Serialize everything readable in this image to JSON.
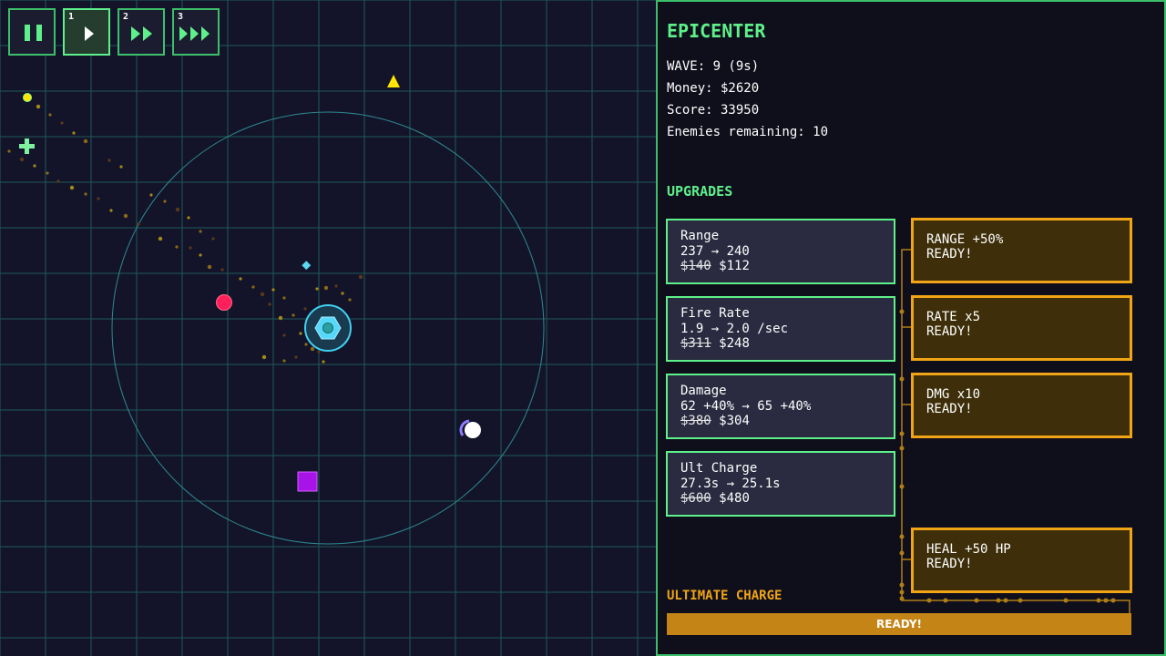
{
  "colors": {
    "accent": "#5ef08a",
    "ultimate": "#f0a416",
    "range_ring": "#2e8a90",
    "tower": "#40d0f0"
  },
  "speed_controls": [
    {
      "hotkey": "1",
      "icon": "play-icon"
    },
    {
      "hotkey": "2",
      "icon": "fast-forward-icon"
    },
    {
      "hotkey": "3",
      "icon": "triple-fast-forward-icon"
    }
  ],
  "pause_icon": "pause-icon",
  "panel": {
    "title": "EPICENTER",
    "wave": "WAVE: 9 (9s)",
    "money": "Money: $2620",
    "score": "Score: 33950",
    "enemies": "Enemies remaining: 10",
    "upgrades_heading": "UPGRADES",
    "upgrades": [
      {
        "name": "Range",
        "change": "237 → 240",
        "old_price": "$140",
        "price": "$112"
      },
      {
        "name": "Fire Rate",
        "change": "1.9 → 2.0 /sec",
        "old_price": "$311",
        "price": "$248"
      },
      {
        "name": "Damage",
        "change": "62 +40% → 65 +40%",
        "old_price": "$380",
        "price": "$304"
      },
      {
        "name": "Ult Charge",
        "change": "27.3s → 25.1s",
        "old_price": "$600",
        "price": "$480"
      }
    ],
    "ultimates": [
      {
        "name": "RANGE +50%",
        "status": "READY!"
      },
      {
        "name": "RATE x5",
        "status": "READY!"
      },
      {
        "name": "DMG x10",
        "status": "READY!"
      },
      {
        "name": "HEAL +50 HP",
        "status": "READY!"
      }
    ],
    "ultimate_charge_label": "ULTIMATE CHARGE",
    "ultimate_charge_status": "READY!",
    "ultimate_charge_progress": 1.0
  }
}
